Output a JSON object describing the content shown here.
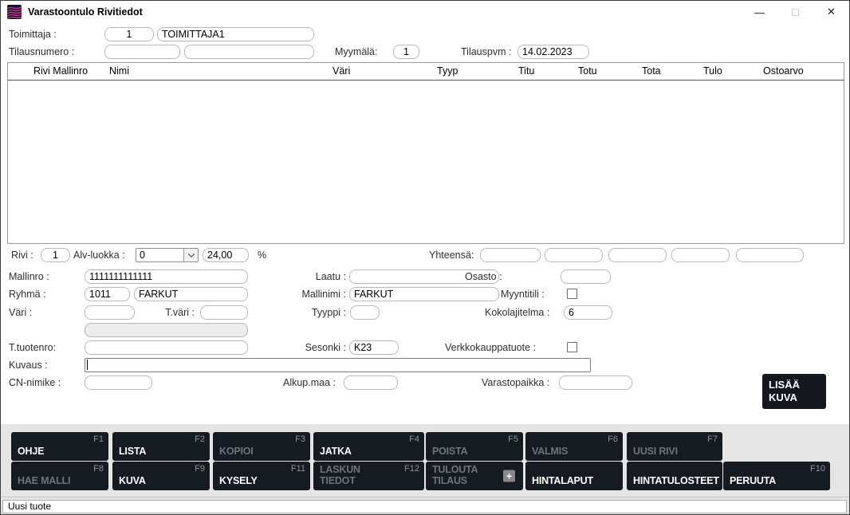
{
  "window": {
    "title": "Varastoontulo Rivitiedot",
    "minimize_glyph": "—",
    "close_glyph": "✕",
    "status_text": "Uusi tuote"
  },
  "header": {
    "toimittaja_label": "Toimittaja :",
    "toimittaja_code": "1",
    "toimittaja_name": "TOIMITTAJA1",
    "tilausnumero_label": "Tilausnumero :",
    "tilausnumero_1": "",
    "tilausnumero_2": "",
    "myymala_label": "Myymälä:",
    "myymala_value": "1",
    "tilauspvm_label": "Tilauspvm :",
    "tilauspvm_value": "14.02.2023"
  },
  "table": {
    "columns": [
      "Rivi Mallinro",
      "Nimi",
      "Väri",
      "Tyyp",
      "Titu",
      "Totu",
      "Tota",
      "Tulo",
      "Ostoarvo"
    ],
    "rows": []
  },
  "totals": {
    "rivi_label": "Rivi :",
    "rivi_value": "1",
    "alv_label": "Alv-luokka :",
    "alv_value": "0",
    "alv_percent": "24,00",
    "percent_sign": "%",
    "yhteensa_label": "Yhteensä:"
  },
  "form": {
    "mallinro_label": "Mallinro :",
    "mallinro_value": "1111111111111",
    "laatu_label": "Laatu :",
    "laatu_value": "",
    "osasto_label": "Osasto :",
    "osasto_value": "",
    "ryhma_label": "Ryhmä :",
    "ryhma_code": "1011",
    "ryhma_name": "FARKUT",
    "mallinimi_label": "Mallinimi :",
    "mallinimi_value": "FARKUT",
    "myyntitili_label": "Myyntitili :",
    "myyntitili_checked": false,
    "vari_label": "Väri :",
    "vari_value": "",
    "tvari_label": "T.väri :",
    "tvari_value": "",
    "tyyppi_label": "Tyyppi :",
    "tyyppi_value": "",
    "kokolajitelma_label": "Kokolajitelma :",
    "kokolajitelma_value": "6",
    "vari_extra_value": "",
    "ttuotenro_label": "T.tuotenro:",
    "ttuotenro_value": "",
    "sesonki_label": "Sesonki :",
    "sesonki_value": "K23",
    "verkkokauppa_label": "Verkkokauppatuote :",
    "verkkokauppa_checked": false,
    "kuvaus_label": "Kuvaus :",
    "kuvaus_value": "",
    "cn_label": "CN-nimike :",
    "cn_value": "",
    "alkupmaa_label": "Alkup.maa :",
    "alkupmaa_value": "",
    "varastopaikka_label": "Varastopaikka :",
    "varastopaikka_value": ""
  },
  "image_button": {
    "label": "LISÄÄ\nKUVA"
  },
  "toolbar": {
    "plus_glyph": "+",
    "row1": [
      {
        "label": "OHJE",
        "fkey": "F1",
        "enabled": true
      },
      {
        "label": "LISTA",
        "fkey": "F2",
        "enabled": true
      },
      {
        "label": "KOPIOI",
        "fkey": "F3",
        "enabled": false
      },
      {
        "label": "JATKA",
        "fkey": "F4",
        "enabled": true
      },
      {
        "label": "POISTA",
        "fkey": "F5",
        "enabled": false
      },
      {
        "label": "VALMIS",
        "fkey": "F6",
        "enabled": false
      },
      {
        "label": "UUSI RIVI",
        "fkey": "F7",
        "enabled": false
      }
    ],
    "row2": [
      {
        "label": "HAE MALLI",
        "fkey": "F8",
        "enabled": false
      },
      {
        "label": "KUVA",
        "fkey": "F9",
        "enabled": true
      },
      {
        "label": "KYSELY",
        "fkey": "F11",
        "enabled": true
      },
      {
        "label": "LASKUN\nTIEDOT",
        "fkey": "F12",
        "enabled": false
      },
      {
        "label": "TULOUTA\nTILAUS",
        "fkey": "",
        "enabled": false,
        "plus_icon": true
      },
      {
        "label": "HINTALAPUT",
        "fkey": "",
        "enabled": true
      },
      {
        "label": "HINTATULOSTEET",
        "fkey": "",
        "enabled": true
      },
      {
        "label": "PERUUTA",
        "fkey": "F10",
        "enabled": true
      }
    ]
  }
}
